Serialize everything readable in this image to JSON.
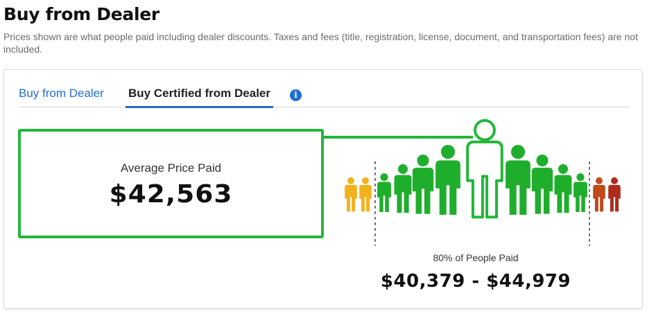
{
  "page": {
    "title": "Buy from Dealer",
    "subtitle": "Prices shown are what people paid including dealer discounts. Taxes and fees (title, registration, license, document, and transportation fees) are not included."
  },
  "tabs": [
    {
      "label": "Buy from Dealer",
      "active": false
    },
    {
      "label": "Buy Certified from Dealer",
      "active": true
    }
  ],
  "info_icon": {
    "name": "info-icon",
    "glyph": "i"
  },
  "average": {
    "label": "Average Price Paid",
    "value": "$42,563"
  },
  "range": {
    "label": "80% of People Paid",
    "value": "$40,379 - $44,979"
  },
  "colors": {
    "accent_blue": "#1f6fd1",
    "green": "#22b73a",
    "green_person": "#1fae2c",
    "yellow": "#f2b21c",
    "orange": "#bf4a1a",
    "red": "#b02b1c"
  },
  "price_distribution_icons": [
    "yellow-person",
    "yellow-person",
    "green-person",
    "green-person",
    "green-person",
    "green-person",
    "highlighted-person-outline",
    "green-person",
    "green-person",
    "green-person",
    "green-person",
    "orange-person",
    "red-person"
  ]
}
